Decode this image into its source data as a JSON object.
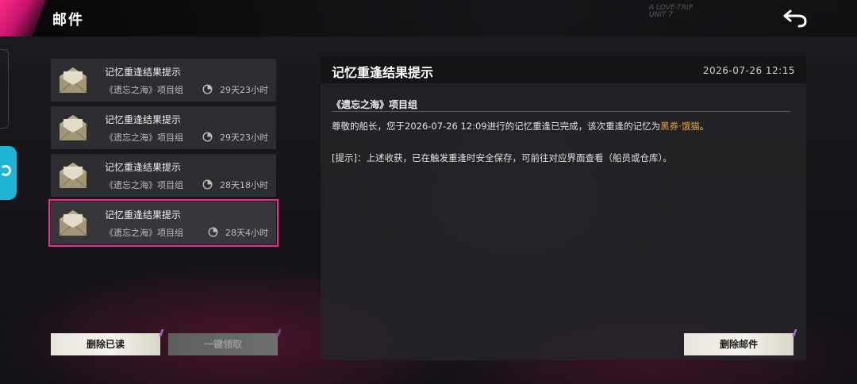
{
  "header": {
    "title": "邮件",
    "watermark_line1": "A LOVE-TRIP",
    "watermark_line2": "UNIT 7"
  },
  "mails": [
    {
      "title": "记忆重逢结果提示",
      "sender": "《遗忘之海》项目组",
      "time_left": "29天23小时",
      "selected": false
    },
    {
      "title": "记忆重逢结果提示",
      "sender": "《遗忘之海》项目组",
      "time_left": "29天23小时",
      "selected": false
    },
    {
      "title": "记忆重逢结果提示",
      "sender": "《遗忘之海》项目组",
      "time_left": "28天18小时",
      "selected": false
    },
    {
      "title": "记忆重逢结果提示",
      "sender": "《遗忘之海》项目组",
      "time_left": "28天4小时",
      "selected": true
    }
  ],
  "buttons": {
    "delete_read": "删除已读",
    "claim_all": "一键领取",
    "delete_mail": "删除邮件"
  },
  "detail": {
    "title": "记忆重逢结果提示",
    "date": "2026-07-26 12:15",
    "sender": "《遗忘之海》项目组",
    "body_prefix": "尊敬的船长，您于2026-07-26 12:09进行的记忆重逢已完成，该次重逢的记忆为",
    "body_highlight": "黑券·饿猫",
    "body_suffix": "。",
    "hint": "[提示]：上述收获，已在触发重逢时安全保存，可前往对应界面查看（船员或仓库）。"
  },
  "icons": {
    "back": "back-arrow-icon",
    "mail": "envelope-icon",
    "timer": "clock-icon"
  },
  "colors": {
    "accent_pink": "#ff1f9a",
    "highlight_orange": "#e8a23a",
    "side_tab_cyan": "#1fb5d6"
  }
}
